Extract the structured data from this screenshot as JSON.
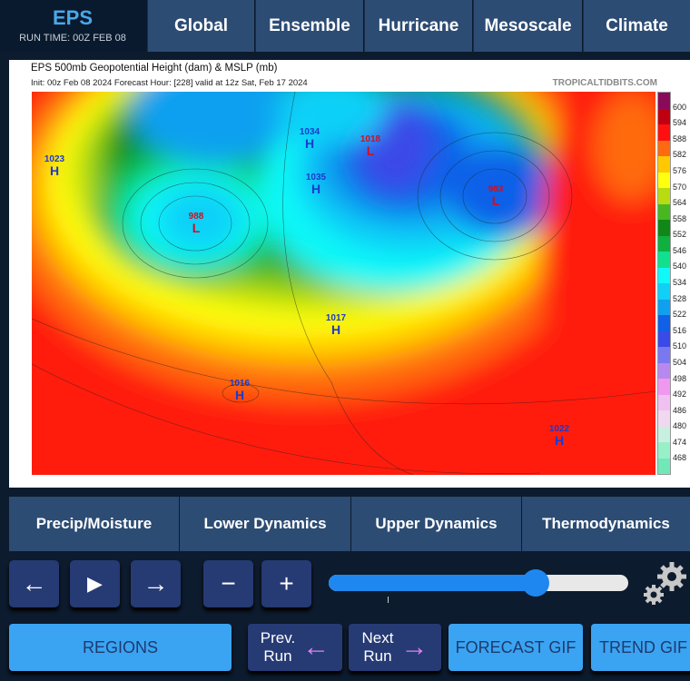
{
  "header": {
    "brand": "EPS",
    "run_time": "RUN TIME: 00Z FEB 08",
    "nav": [
      "Global",
      "Ensemble",
      "Hurricane",
      "Mesoscale",
      "Climate"
    ]
  },
  "map": {
    "title": "EPS 500mb Geopotential Height (dam) & MSLP (mb)",
    "subtitle": "Init: 00z Feb 08 2024   Forecast Hour: [228]   valid at 12z Sat, Feb 17 2024",
    "watermark": "TROPICALTIDBITS.COM",
    "colorbar": {
      "labels": [
        "600",
        "594",
        "588",
        "582",
        "576",
        "570",
        "564",
        "558",
        "552",
        "546",
        "540",
        "534",
        "528",
        "522",
        "516",
        "510",
        "504",
        "498",
        "492",
        "486",
        "480",
        "474",
        "468"
      ],
      "colors": [
        "#8a0a5a",
        "#c00010",
        "#ff1010",
        "#ff6a10",
        "#ffc800",
        "#ffff10",
        "#b8dc10",
        "#48b820",
        "#108818",
        "#10b040",
        "#10e090",
        "#10f8f8",
        "#10d0f8",
        "#10a0f0",
        "#1060e8",
        "#3a4ae8",
        "#7a78f0",
        "#b888f0",
        "#f098f0",
        "#f0c0f0",
        "#f0d8f0",
        "#c8f0e0",
        "#98f0c8",
        "#70e8b8"
      ]
    },
    "centers": [
      {
        "type": "H",
        "value": "1023"
      },
      {
        "type": "L",
        "value": "988"
      },
      {
        "type": "H",
        "value": "1034"
      },
      {
        "type": "L",
        "value": "1018"
      },
      {
        "type": "H",
        "value": "1035"
      },
      {
        "type": "L",
        "value": "983"
      },
      {
        "type": "H",
        "value": "1017"
      },
      {
        "type": "H",
        "value": "1016"
      },
      {
        "type": "H",
        "value": "1022"
      }
    ]
  },
  "categories": [
    "Precip/Moisture",
    "Lower Dynamics",
    "Upper Dynamics",
    "Thermodynamics"
  ],
  "controls": {
    "prev": "←",
    "play": "▶",
    "next": "→",
    "minus": "−",
    "plus": "+",
    "slider_value": 0.69
  },
  "bottom": {
    "regions": "REGIONS",
    "prev_run": [
      "Prev.",
      "Run"
    ],
    "next_run": [
      "Next",
      "Run"
    ],
    "forecast_gif": "FORECAST GIF",
    "trend_gif": "TREND GIF"
  }
}
